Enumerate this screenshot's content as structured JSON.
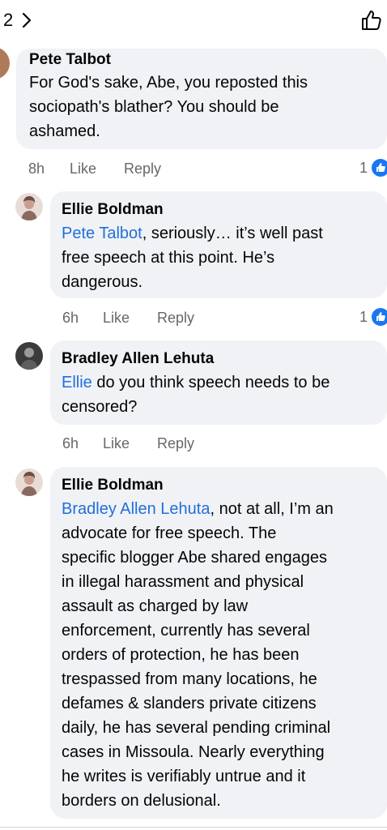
{
  "header": {
    "count": "2",
    "chevron_icon": "chevron-right-icon",
    "like_icon": "thumbs-up-outline-icon"
  },
  "comments": [
    {
      "author": "Pete Talbot",
      "mention": "",
      "lines": [
        "For God's sake, Abe, you reposted this",
        "sociopath's blather? You should be",
        "ashamed."
      ],
      "time": "8h",
      "like_label": "Like",
      "reply_label": "Reply",
      "reaction_count": "1"
    },
    {
      "author": "Ellie Boldman",
      "mention": "Pete Talbot",
      "lines": [
        ", seriously… it’s well past",
        "free speech at this point. He’s",
        "dangerous."
      ],
      "time": "6h",
      "like_label": "Like",
      "reply_label": "Reply",
      "reaction_count": "1"
    },
    {
      "author": "Bradley Allen Lehuta",
      "mention": "Ellie",
      "lines": [
        " do you think speech needs to be",
        "censored?"
      ],
      "time": "6h",
      "like_label": "Like",
      "reply_label": "Reply",
      "reaction_count": ""
    },
    {
      "author": "Ellie Boldman",
      "mention": "Bradley Allen Lehuta",
      "lines": [
        ", not at all, I’m an",
        "advocate for free speech. The",
        "specific blogger Abe shared engages",
        "in illegal harassment and physical",
        "assault as charged by law",
        "enforcement, currently has several",
        "orders of protection, he has been",
        "trespassed from many locations, he",
        "defames & slanders private citizens",
        "daily, he has several pending criminal",
        "cases in Missoula. Nearly everything",
        "he writes is verifiably untrue and it",
        "borders on delusional."
      ],
      "time": "",
      "like_label": "",
      "reply_label": "",
      "reaction_count": ""
    }
  ],
  "colors": {
    "bubble": "#f0f2f5",
    "mention": "#216fdb",
    "meta": "#65676b",
    "like_badge": "#1877f2"
  }
}
